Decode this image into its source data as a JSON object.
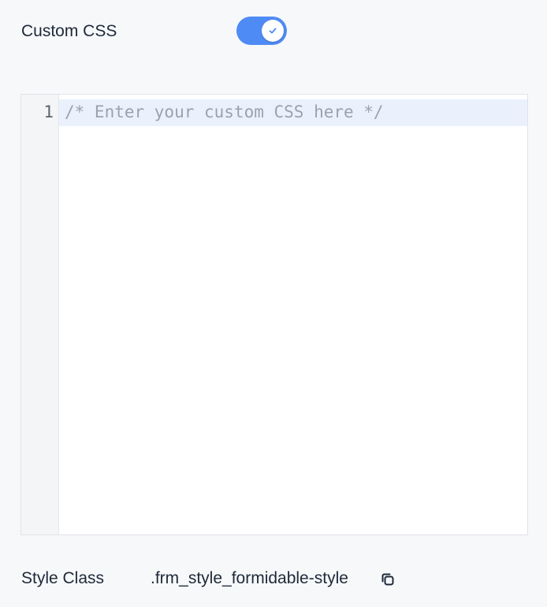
{
  "custom_css": {
    "label": "Custom CSS",
    "toggle": {
      "state": "on",
      "icon": "check-icon",
      "color": "#4f8bf5"
    }
  },
  "editor": {
    "line_numbers": [
      "1"
    ],
    "lines": [
      "/* Enter your custom CSS here */"
    ]
  },
  "style_class": {
    "label": "Style Class",
    "value": ".frm_style_formidable-style",
    "copy_icon": "copy-icon"
  }
}
